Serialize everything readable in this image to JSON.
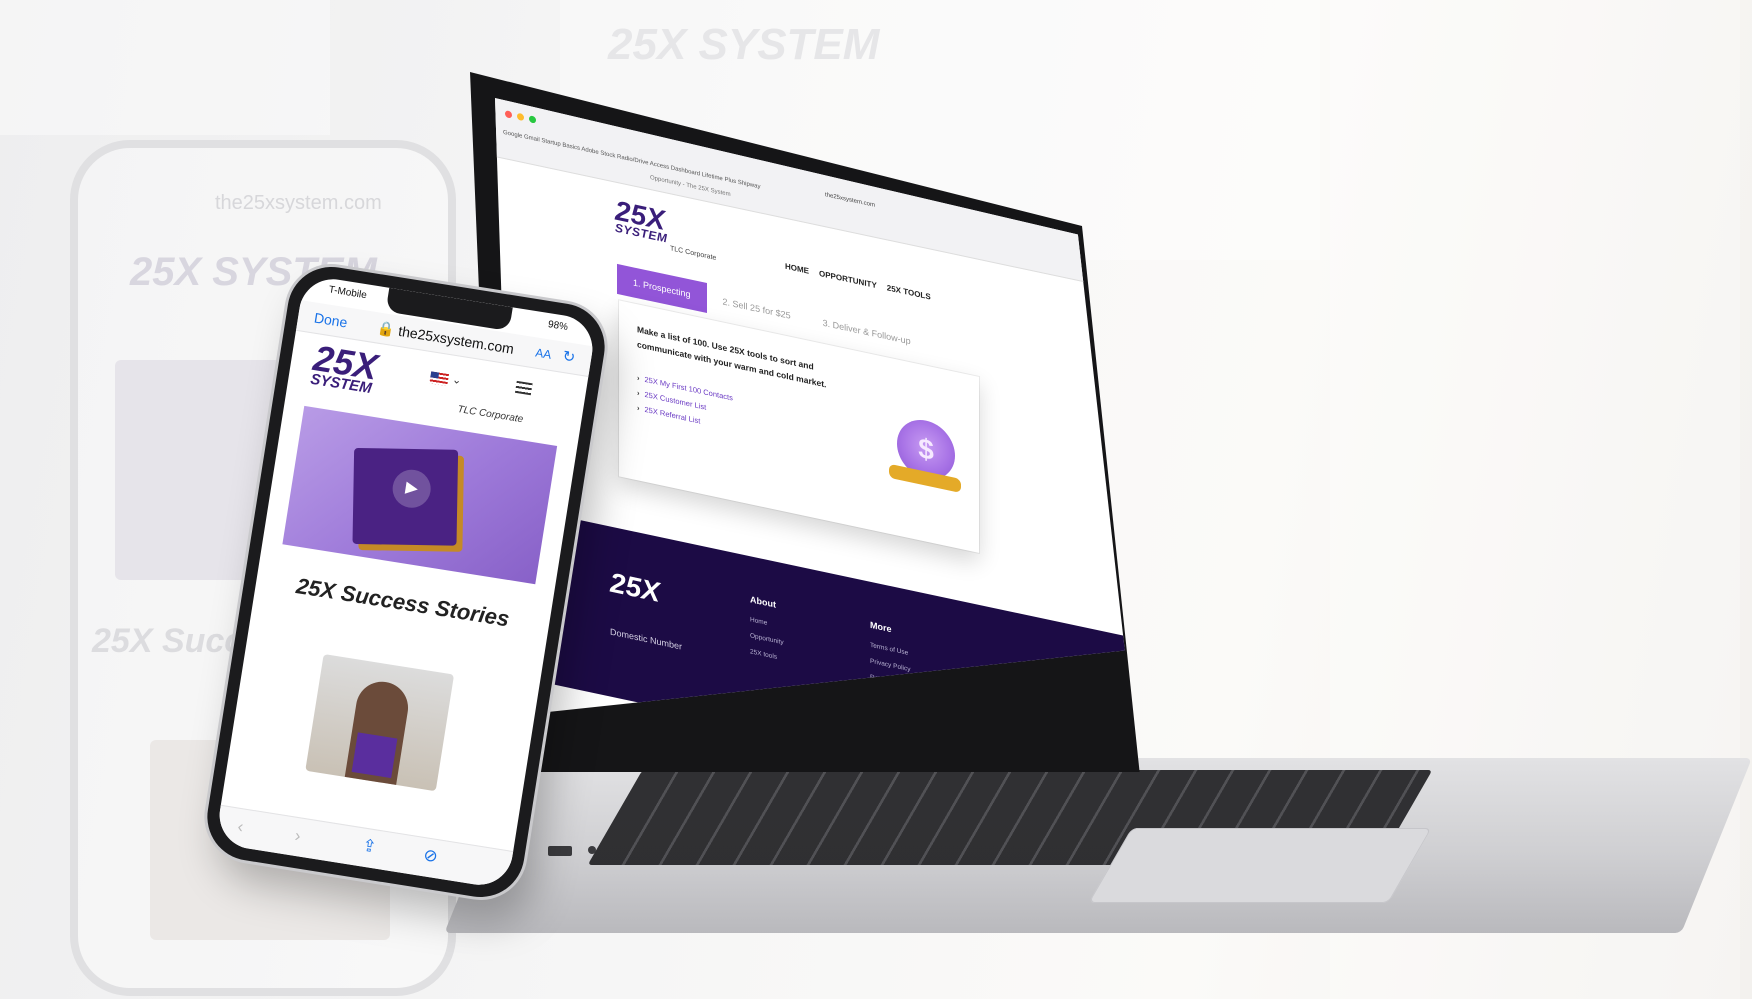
{
  "background": {
    "ghost_url": "the25xsystem.com",
    "ghost_logo": "25X SYSTEM",
    "ghost_heading": "25X Success"
  },
  "laptop": {
    "browser": {
      "bookmarks": "Google  Gmail  Startup Basics  Adobe Stock  Radio/Drive Access  Dashboard  Lifetime Plus  Shipway",
      "tab_title": "Opportunity - The 25X System",
      "url": "the25xsystem.com"
    },
    "site": {
      "logo_top": "25X",
      "logo_bottom": "SYSTEM",
      "subtitle": "TLC Corporate",
      "nav": [
        "HOME",
        "OPPORTUNITY",
        "25X TOOLS"
      ],
      "tabs": [
        "1. Prospecting",
        "2. Sell 25 for $25",
        "3. Deliver & Follow-up"
      ],
      "card_text": "Make a list of 100. Use 25X tools to sort and communicate with your warm and cold market.",
      "links": [
        "25X My First 100 Contacts",
        "25X Customer List",
        "25X Referral List"
      ],
      "footer": {
        "logo": "25X",
        "domestic": "Domestic Number",
        "about_heading": "About",
        "about_items": [
          "Home",
          "Opportunity",
          "25X tools"
        ],
        "more_heading": "More",
        "more_items": [
          "Terms of Use",
          "Privacy Policy",
          "Return Policy"
        ]
      }
    }
  },
  "phone": {
    "carrier": "T-Mobile",
    "battery": "98%",
    "safari_done": "Done",
    "safari_url": "the25xsystem.com",
    "safari_aa": "AA",
    "logo_top": "25X",
    "logo_bottom": "SYSTEM",
    "tlc": "TLC Corporate",
    "heading": "25X Success Stories"
  },
  "colors": {
    "accent": "#9255d8",
    "brand_dark": "#3a1e7a",
    "footer_bg": "#1c0b45",
    "link": "#6b3bc4"
  },
  "icons": [
    "play-icon",
    "share-icon",
    "compass-icon",
    "back-icon",
    "forward-icon",
    "reload-icon",
    "menu-icon",
    "flag-icon",
    "money-bag-icon",
    "chevron-right-icon"
  ]
}
